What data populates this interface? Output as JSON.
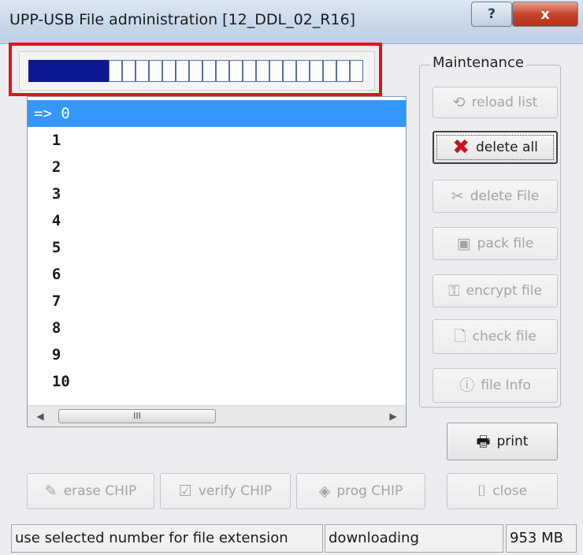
{
  "window": {
    "title": "UPP-USB File administration [12_DDL_02_R16]",
    "help_button": "?",
    "close_button": "x"
  },
  "progress": {
    "filled_blocks": 6,
    "total_blocks": 25,
    "fraction": 0.24,
    "color": "#0d1990"
  },
  "file_list": {
    "items": [
      "=> 0",
      "  1",
      "  2",
      "  3",
      "  4",
      "  5",
      "  6",
      "  7",
      "  8",
      "  9",
      "  10"
    ],
    "selected_index": 0,
    "scrollbar_thumb_glyph": "III",
    "scroll_left_arrow": "◀",
    "scroll_right_arrow": "▶"
  },
  "maintenance": {
    "group_label": "Maintenance",
    "reload_list": "reload list",
    "delete_all": "delete all",
    "delete_file": "delete File",
    "pack_file": "pack file",
    "encrypt_file": "encrypt file",
    "check_file": "check file",
    "file_info": "file Info"
  },
  "actions": {
    "print": "print",
    "erase_chip": "erase CHIP",
    "verify_chip": "verify CHIP",
    "prog_chip": "prog CHIP",
    "close": "close"
  },
  "status": {
    "hint": "use selected number for file extension",
    "state": "downloading",
    "size": "953 MB"
  },
  "colors": {
    "selection": "#3399ff",
    "highlight_border": "#e2141b",
    "delete_icon": "#c4141a"
  },
  "icons": {
    "reload": "reload-icon",
    "delete_all": "red-x-icon",
    "delete_file": "scissors-icon",
    "pack": "floppy-icon",
    "encrypt": "key-icon",
    "check": "document-icon",
    "info": "info-icon",
    "print": "printer-icon",
    "erase": "eraser-icon",
    "verify": "checklist-icon",
    "prog": "chip-icon",
    "close": "door-icon"
  }
}
